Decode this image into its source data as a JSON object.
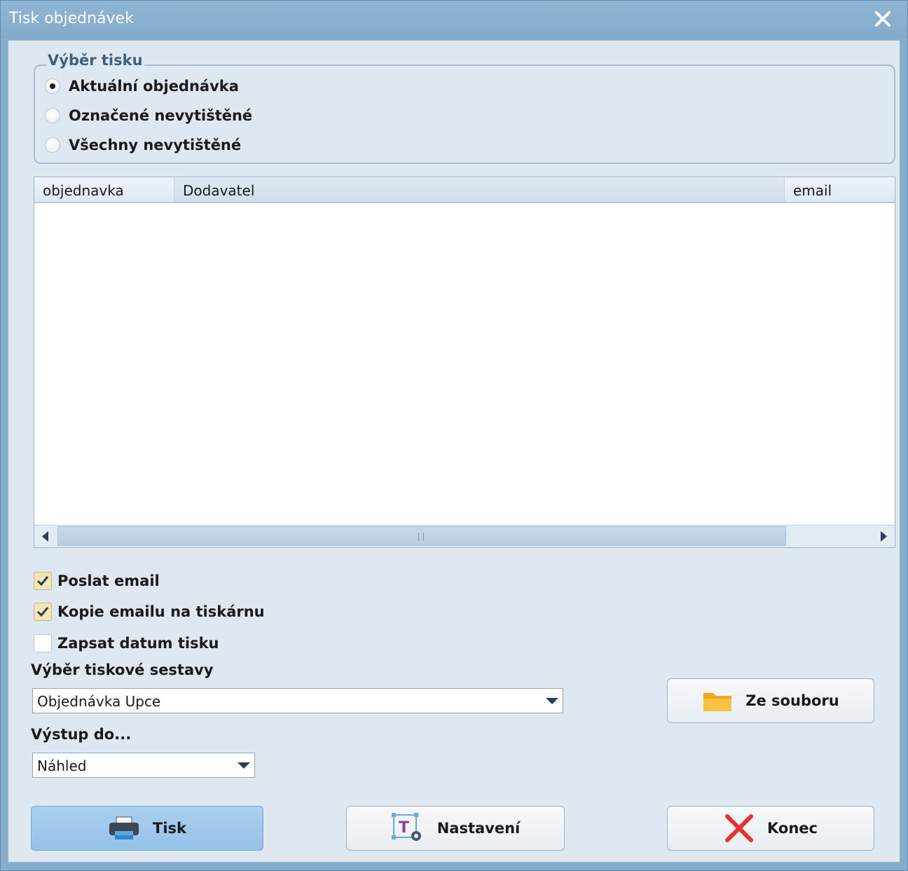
{
  "window": {
    "title": "Tisk objednávek"
  },
  "print_selection": {
    "legend": "Výběr tisku",
    "options": [
      {
        "label": "Aktuální objednávka",
        "checked": true
      },
      {
        "label": "Označené nevytištěné",
        "checked": false
      },
      {
        "label": "Všechny nevytištěné",
        "checked": false
      }
    ]
  },
  "grid": {
    "columns": [
      "objednavka",
      "Dodavatel",
      "email"
    ],
    "rows": []
  },
  "options": {
    "send_email": {
      "label": "Poslat email",
      "checked": true
    },
    "copy_to_printer": {
      "label": "Kopie emailu na tiskárnu",
      "checked": true
    },
    "write_print_date": {
      "label": "Zapsat datum tisku",
      "checked": false
    }
  },
  "report": {
    "label": "Výběr tiskové sestavy",
    "selected": "Objednávka Upce"
  },
  "output": {
    "label": "Výstup do...",
    "selected": "Náhled"
  },
  "buttons": {
    "from_file": "Ze souboru",
    "print": "Tisk",
    "settings": "Nastavení",
    "close": "Konec"
  },
  "colors": {
    "titlebar": "#86aecc",
    "client_bg": "#dfe7f0",
    "primary_button": "#9fc8ec",
    "close_x": "#e8322c",
    "folder": "#f5b82e"
  }
}
